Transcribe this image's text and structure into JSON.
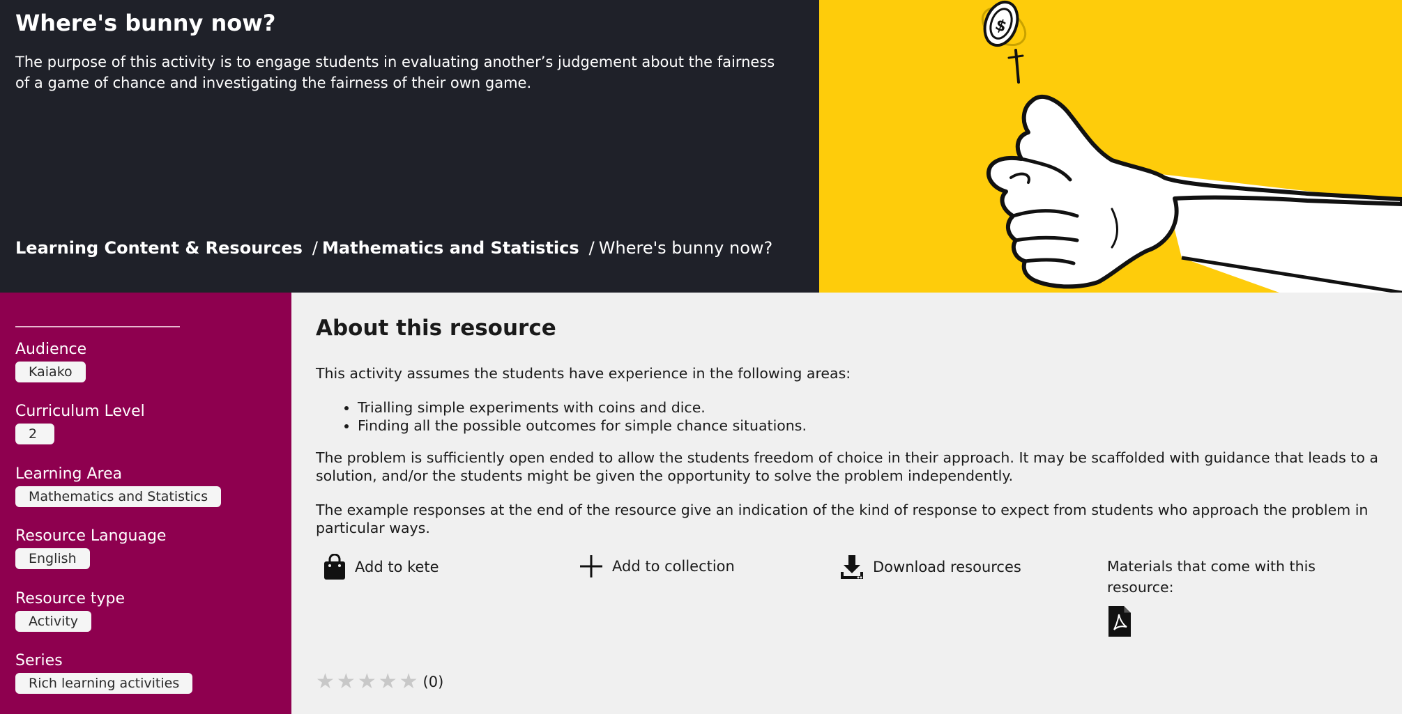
{
  "hero": {
    "title": "Where's bunny now?",
    "description": "The purpose of this activity is to engage students in evaluating another’s judgement about the fairness of a game of chance and investigating the fairness of their own game.",
    "breadcrumb": {
      "item1": "Learning Content & Resources",
      "item2": "Mathematics and Statistics",
      "current": "Where's bunny now?",
      "separator": "/"
    },
    "image": "hand-flipping-coin-illustration"
  },
  "sidebar": {
    "audience": {
      "label": "Audience",
      "value": "Kaiako"
    },
    "curriculum": {
      "label": "Curriculum Level",
      "value": "2"
    },
    "learning_area": {
      "label": "Learning Area",
      "value": "Mathematics and Statistics"
    },
    "language": {
      "label": "Resource Language",
      "value": "English"
    },
    "type": {
      "label": "Resource type",
      "value": "Activity"
    },
    "series": {
      "label": "Series",
      "value": "Rich learning activities"
    }
  },
  "main": {
    "heading": "About this resource",
    "intro": "This activity assumes the students have experience in the following areas:",
    "bullets": [
      "Trialling simple experiments with coins and dice.",
      "Finding all the possible outcomes for simple chance situations."
    ],
    "para2": "The problem is sufficiently open ended to allow the students freedom of choice in their approach. It may be scaffolded with guidance that leads to a solution, and/or the students might be given the opportunity to solve the problem independently.",
    "para3": "The example responses at the end of the resource give an indication of the kind of response to expect from students who approach the problem in particular ways.",
    "actions": {
      "kete": "Add to kete",
      "collection": "Add to collection",
      "download": "Download resources"
    },
    "materials_label": "Materials that come with this resource:",
    "rating": {
      "stars_filled": 0,
      "stars_total": 5,
      "count": "(0)"
    }
  },
  "colors": {
    "hero_bg": "#1f2129",
    "image_bg": "#fecc0b",
    "sidebar_bg": "#8e004f",
    "main_bg": "#f0f0f0",
    "star_empty": "#c8c8c8"
  }
}
